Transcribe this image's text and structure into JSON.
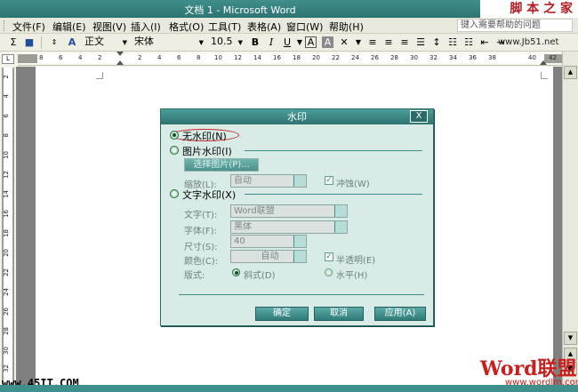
{
  "window": {
    "title": "文档 1 - Microsoft Word",
    "site_logo": "脚 本 之 家"
  },
  "menu": {
    "items": [
      "文件(F)",
      "编辑(E)",
      "视图(V)",
      "插入(I)",
      "格式(O)",
      "工具(T)",
      "表格(A)",
      "窗口(W)",
      "帮助(H)"
    ],
    "help_placeholder": "键入需要帮助的问题"
  },
  "toolbar": {
    "style_value": "正文",
    "font_value": "宋体",
    "size_value": "10.5",
    "bold": "B",
    "italic": "I",
    "underline": "U",
    "site_url": "www.Jb51.net"
  },
  "ruler": {
    "ticks": [
      "8",
      "6",
      "4",
      "2",
      "2",
      "4",
      "6",
      "8",
      "10",
      "12",
      "14",
      "16",
      "18",
      "20",
      "22",
      "24",
      "26",
      "28",
      "30",
      "32",
      "34",
      "36",
      "38",
      "40",
      "42"
    ],
    "vticks": [
      "2",
      "4",
      "6",
      "8",
      "10",
      "12",
      "14",
      "16",
      "18",
      "20",
      "22",
      "24",
      "26",
      "28",
      "30",
      "32",
      "34"
    ]
  },
  "dialog": {
    "title": "水印",
    "close": "X",
    "no_watermark": "无水印(N)",
    "picture_watermark": "图片水印(I)",
    "select_picture": "选择图片(P)...",
    "scale_label": "缩放(L):",
    "scale_value": "自动",
    "washout_label": "冲蚀(W)",
    "text_watermark": "文字水印(X)",
    "text_label": "文字(T):",
    "text_value": "Word联盟",
    "font_label": "字体(F):",
    "font_value": "黑体",
    "size_label": "尺寸(S):",
    "size_value": "40",
    "color_label": "颜色(C):",
    "color_value": "自动",
    "semitransparent_label": "半透明(E)",
    "layout_label": "版式:",
    "diagonal_label": "斜式(D)",
    "horizontal_label": "水平(H)",
    "ok": "确定",
    "cancel": "取消",
    "apply": "应用(A)"
  },
  "watermarks": {
    "bottom_left": "www.45IT.COM",
    "logo": "Word联盟",
    "logo_url": "www.wordlm.com"
  },
  "colors": {
    "title_bar": "#3f8f8c",
    "dialog_bg": "#d9ebe6",
    "highlight": "#d0202a"
  }
}
